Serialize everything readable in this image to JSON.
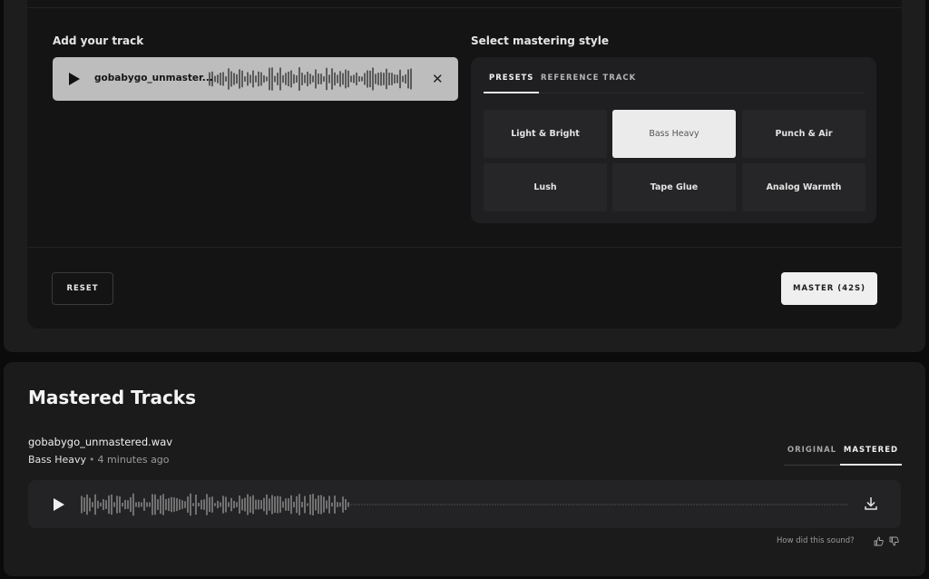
{
  "upload": {
    "add_track_label": "Add your track",
    "track_file_name": "gobabygo_unmaster...",
    "remove_symbol": "✕"
  },
  "style": {
    "select_label": "Select mastering style",
    "tabs": [
      {
        "label": "PRESETS",
        "active": true
      },
      {
        "label": "REFERENCE TRACK",
        "active": false
      }
    ],
    "presets": [
      {
        "label": "Light & Bright",
        "active": false
      },
      {
        "label": "Bass Heavy",
        "active": true
      },
      {
        "label": "Punch & Air",
        "active": false
      },
      {
        "label": "Lush",
        "active": false
      },
      {
        "label": "Tape Glue",
        "active": false
      },
      {
        "label": "Analog Warmth",
        "active": false
      }
    ]
  },
  "actions": {
    "reset_label": "RESET",
    "master_label": "MASTER (42S)"
  },
  "mastered": {
    "section_title": "Mastered Tracks",
    "file_name": "gobabygo_unmastered.wav",
    "preset": "Bass Heavy",
    "separator": "•",
    "time_ago": "4 minutes ago",
    "view_tabs": [
      {
        "label": "ORIGINAL",
        "active": false
      },
      {
        "label": "MASTERED",
        "active": true
      }
    ],
    "feedback_prompt": "How did this sound?",
    "playback_progress": 0.35
  },
  "icons": {
    "play": "play-icon",
    "close": "close-icon",
    "download": "download-icon",
    "thumbs_up": "thumbs-up-icon",
    "thumbs_down": "thumbs-down-icon"
  },
  "colors": {
    "background": "#0b0b0c",
    "panel": "#1f1f21",
    "accent_light": "#efefef"
  }
}
